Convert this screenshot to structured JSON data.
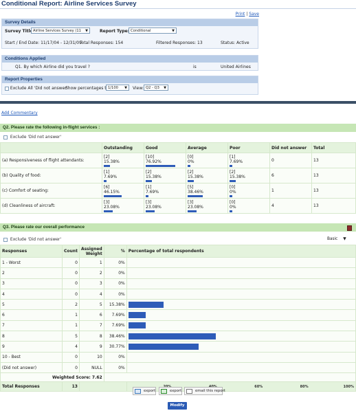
{
  "page": {
    "title": "Conditional Report: Airline Services Survey",
    "links": {
      "print": "Print",
      "sep": "|",
      "save": "Save"
    },
    "add_commentary": "Add Commentary"
  },
  "survey_details": {
    "heading": "Survey Details",
    "survey_title_label": "Survey Title:",
    "survey_title_value": "Airline Services Survey (11",
    "report_type_label": "Report Type:",
    "report_type_value": "Conditional",
    "dates": "Start / End Date: 11/17/04 - 12/31/09",
    "total_responses": "Total Responses: 154",
    "filtered_responses": "Filtered Responses: 13",
    "status": "Status: Active"
  },
  "conditions": {
    "heading": "Conditions Applied",
    "question": "Q1. By which Airline did you travel ?",
    "operator": "is",
    "value": "United Airlines"
  },
  "report_properties": {
    "heading": "Report Properties",
    "exclude_label": "Exclude All 'Did not answer'",
    "percent_label": "Show percentages to:",
    "percent_value": "1/100",
    "view_label": "View:",
    "view_value": "Q2 - Q3"
  },
  "q2": {
    "heading": "Q2.   Please rate the following in-flight services :",
    "exclude_label": "Exclude 'Did not answer'",
    "columns": [
      "Outstanding",
      "Good",
      "Average",
      "Poor",
      "Did not answer",
      "Total"
    ],
    "rows": [
      {
        "label": "(a) Responsiveness of flight attendants:",
        "cells": [
          [
            "[2]",
            "15.38%",
            15.38
          ],
          [
            "[10]",
            "76.92%",
            76.92
          ],
          [
            "[0]",
            "0%",
            0
          ],
          [
            "[1]",
            "7.69%",
            7.69
          ]
        ],
        "dna": "0",
        "total": "13"
      },
      {
        "label": "(b) Quality of food:",
        "cells": [
          [
            "[1]",
            "7.69%",
            7.69
          ],
          [
            "[2]",
            "15.38%",
            15.38
          ],
          [
            "[2]",
            "15.38%",
            15.38
          ],
          [
            "[2]",
            "15.38%",
            15.38
          ]
        ],
        "dna": "6",
        "total": "13"
      },
      {
        "label": "(c) Comfort of seating:",
        "cells": [
          [
            "[6]",
            "46.15%",
            46.15
          ],
          [
            "[1]",
            "7.69%",
            7.69
          ],
          [
            "[5]",
            "38.46%",
            38.46
          ],
          [
            "[0]",
            "0%",
            0
          ]
        ],
        "dna": "1",
        "total": "13"
      },
      {
        "label": "(d) Cleanliness of aircraft:",
        "cells": [
          [
            "[3]",
            "23.08%",
            23.08
          ],
          [
            "[3]",
            "23.08%",
            23.08
          ],
          [
            "[3]",
            "23.08%",
            23.08
          ],
          [
            "[0]",
            "0%",
            0
          ]
        ],
        "dna": "4",
        "total": "13"
      }
    ]
  },
  "q3": {
    "heading": "Q3.   Please rate our overall performance",
    "exclude_label": "Exclude 'Did not answer'",
    "view_mode": "Basic",
    "columns": {
      "responses": "Responses",
      "count": "Count",
      "weight": "Assigned Weight",
      "pct": "%",
      "pct_total": "Percentage of total respondents"
    },
    "rows": [
      {
        "label": "1 - Worst",
        "count": "0",
        "weight": "1",
        "pct": "0%",
        "value": 0
      },
      {
        "label": "2",
        "count": "0",
        "weight": "2",
        "pct": "0%",
        "value": 0
      },
      {
        "label": "3",
        "count": "0",
        "weight": "3",
        "pct": "0%",
        "value": 0
      },
      {
        "label": "4",
        "count": "0",
        "weight": "4",
        "pct": "0%",
        "value": 0
      },
      {
        "label": "5",
        "count": "2",
        "weight": "5",
        "pct": "15.38%",
        "value": 15.38
      },
      {
        "label": "6",
        "count": "1",
        "weight": "6",
        "pct": "7.69%",
        "value": 7.69
      },
      {
        "label": "7",
        "count": "1",
        "weight": "7",
        "pct": "7.69%",
        "value": 7.69
      },
      {
        "label": "8",
        "count": "5",
        "weight": "8",
        "pct": "38.46%",
        "value": 38.46
      },
      {
        "label": "9",
        "count": "4",
        "weight": "9",
        "pct": "30.77%",
        "value": 30.77
      },
      {
        "label": "10 - Best",
        "count": "0",
        "weight": "10",
        "pct": "0%",
        "value": 0
      },
      {
        "label": "(Did not answer)",
        "count": "0",
        "weight": "NULL",
        "pct": "0%",
        "value": 0
      }
    ],
    "weighted_score": "Weighted Score: 7.62",
    "total_label": "Total Responses",
    "total_count": "13",
    "axis_ticks": [
      "20%",
      "40%",
      "60%",
      "80%",
      "100%"
    ]
  },
  "buttons": {
    "export1": "export",
    "export2": "export",
    "email": "email this report",
    "modify": "Modify"
  },
  "colors": {
    "bar": "#2e5cb8",
    "section_green": "#c6e6b5",
    "panel_blue": "#b9cde7"
  }
}
